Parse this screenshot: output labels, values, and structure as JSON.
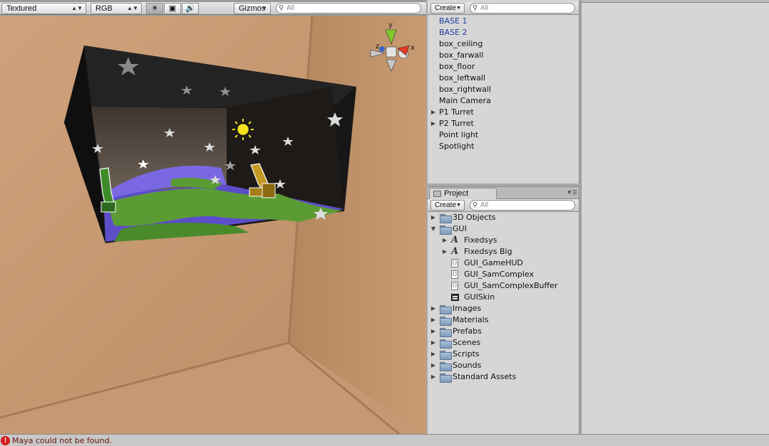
{
  "scene": {
    "render_mode": "Textured",
    "color_mode": "RGB",
    "gizmos_label": "Gizmos",
    "search_placeholder": "All",
    "axis_labels": {
      "y": "y",
      "x": "x",
      "z": "z"
    }
  },
  "hierarchy": {
    "create_label": "Create",
    "search_placeholder": "All",
    "items": [
      {
        "label": "BASE 1",
        "expandable": false,
        "highlighted": true
      },
      {
        "label": "BASE 2",
        "expandable": false,
        "highlighted": true
      },
      {
        "label": "box_ceiling",
        "expandable": false,
        "highlighted": false
      },
      {
        "label": "box_farwall",
        "expandable": false,
        "highlighted": false
      },
      {
        "label": "box_floor",
        "expandable": false,
        "highlighted": false
      },
      {
        "label": "box_leftwall",
        "expandable": false,
        "highlighted": false
      },
      {
        "label": "box_rightwall",
        "expandable": false,
        "highlighted": false
      },
      {
        "label": "Main Camera",
        "expandable": false,
        "highlighted": false
      },
      {
        "label": "P1 Turret",
        "expandable": true,
        "highlighted": false
      },
      {
        "label": "P2 Turret",
        "expandable": true,
        "highlighted": false
      },
      {
        "label": "Point light",
        "expandable": false,
        "highlighted": false
      },
      {
        "label": "Spotlight",
        "expandable": false,
        "highlighted": false
      }
    ]
  },
  "project": {
    "tab_label": "Project",
    "create_label": "Create",
    "search_placeholder": "All",
    "items": [
      {
        "label": "3D Objects",
        "icon": "folder-icon",
        "depth": 0,
        "toggle": "collapsed"
      },
      {
        "label": "GUI",
        "icon": "folder-icon",
        "depth": 0,
        "toggle": "expanded"
      },
      {
        "label": "Fixedsys",
        "icon": "font-icon",
        "depth": 1,
        "toggle": "collapsed"
      },
      {
        "label": "Fixedsys Big",
        "icon": "font-icon",
        "depth": 1,
        "toggle": "collapsed"
      },
      {
        "label": "GUI_GameHUD",
        "icon": "script-icon",
        "depth": 1,
        "toggle": "none"
      },
      {
        "label": "GUI_SamComplex",
        "icon": "script-icon",
        "depth": 1,
        "toggle": "none"
      },
      {
        "label": "GUI_SamComplexBuffer",
        "icon": "script-icon",
        "depth": 1,
        "toggle": "none"
      },
      {
        "label": "GUISkin",
        "icon": "guiskin-icon",
        "depth": 1,
        "toggle": "none"
      },
      {
        "label": "Images",
        "icon": "folder-icon",
        "depth": 0,
        "toggle": "collapsed"
      },
      {
        "label": "Materials",
        "icon": "folder-icon",
        "depth": 0,
        "toggle": "collapsed"
      },
      {
        "label": "Prefabs",
        "icon": "folder-icon",
        "depth": 0,
        "toggle": "collapsed"
      },
      {
        "label": "Scenes",
        "icon": "folder-icon",
        "depth": 0,
        "toggle": "collapsed"
      },
      {
        "label": "Scripts",
        "icon": "folder-icon",
        "depth": 0,
        "toggle": "collapsed"
      },
      {
        "label": "Sounds",
        "icon": "folder-icon",
        "depth": 0,
        "toggle": "collapsed"
      },
      {
        "label": "Standard Assets",
        "icon": "folder-icon",
        "depth": 0,
        "toggle": "collapsed"
      }
    ]
  },
  "status": {
    "message": "Maya could not be found.",
    "icon": "error-icon"
  },
  "colors": {
    "highlight_text": "#1a3e99",
    "error_text": "#6a1010",
    "error_icon": "#d41c1c"
  }
}
